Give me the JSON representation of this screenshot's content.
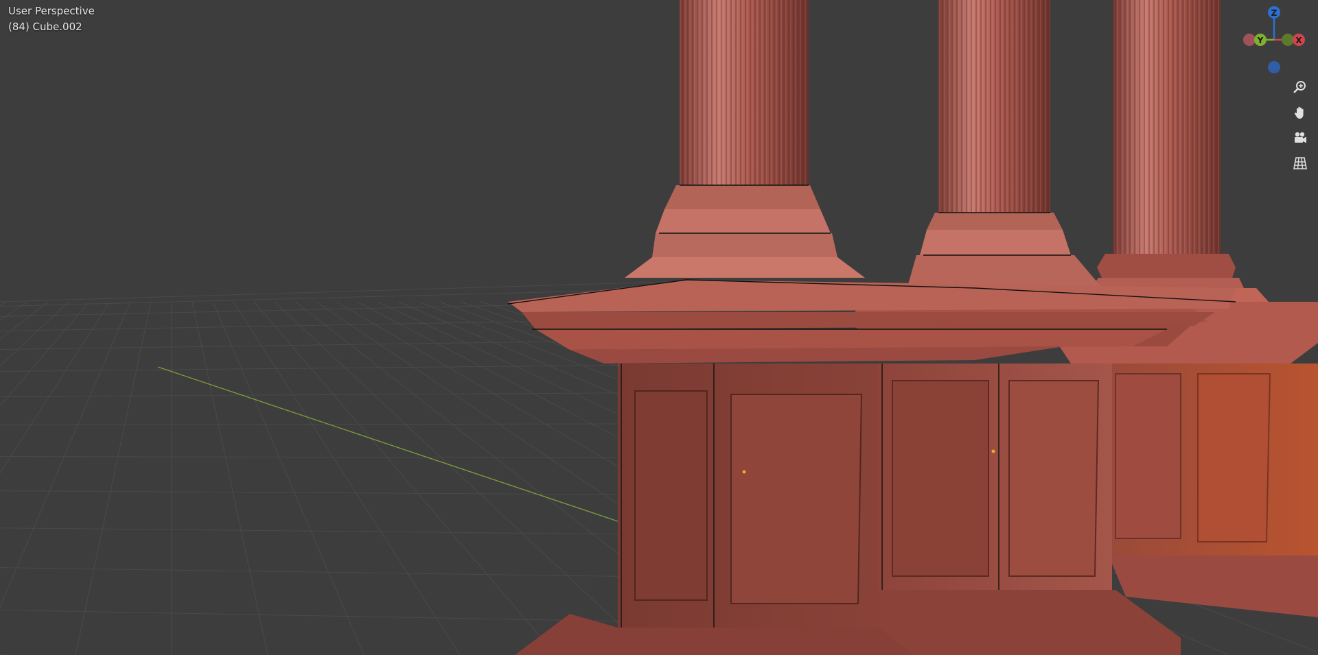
{
  "viewport": {
    "view_name": "User Perspective",
    "object_info": "(84) Cube.002"
  },
  "gizmo": {
    "axes": [
      {
        "name": "Z",
        "color": "#2f6fd1"
      },
      {
        "name": "Y",
        "color": "#7fb12e"
      },
      {
        "name": "X",
        "color": "#d1454f"
      }
    ],
    "negative_axes": [
      {
        "axis": "-Y",
        "color": "#5c7a2b"
      },
      {
        "axis": "-X",
        "color": "#a0525b"
      },
      {
        "axis": "-Z",
        "color": "#2f5da6"
      }
    ]
  },
  "navigation": [
    {
      "id": "zoom",
      "icon": "zoom-in-icon"
    },
    {
      "id": "pan",
      "icon": "hand-icon"
    },
    {
      "id": "camera",
      "icon": "camera-icon"
    },
    {
      "id": "ortho",
      "icon": "grid-icon"
    }
  ],
  "colors": {
    "background": "#3d3d3d",
    "grid_line": "#4a4a4a",
    "x_axis_line": "#7c9a3a",
    "clay": "#a8544a",
    "clay_light": "#c56d61",
    "clay_dark": "#6e322b",
    "vertex": "#111111",
    "origin": "#f5a623"
  }
}
